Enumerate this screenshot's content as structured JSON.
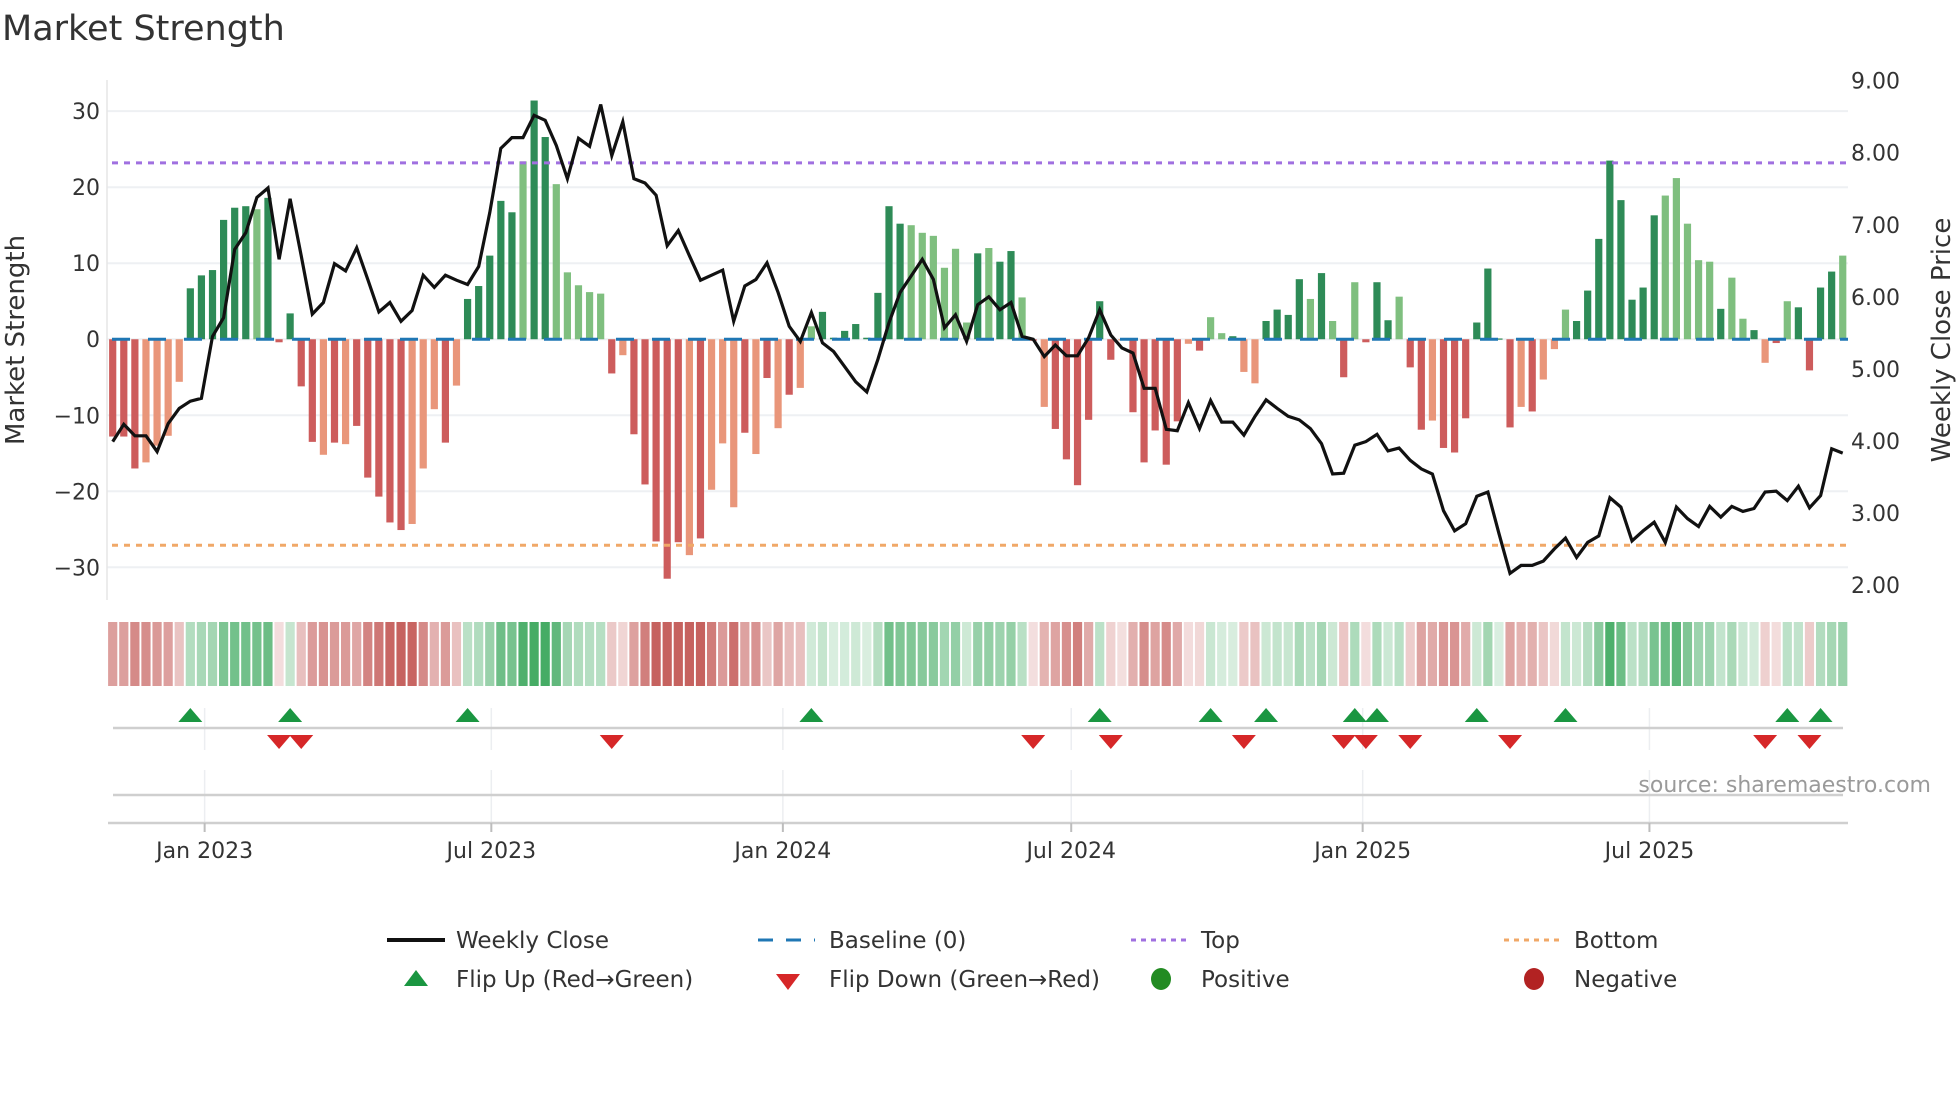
{
  "title": "Market Strength",
  "source": "source: sharemaestro.com",
  "chart_data": {
    "type": "bar+line",
    "title": "Market Strength",
    "ylabel": "Market Strength",
    "y2label": "Weekly Close Price",
    "ylim": [
      -34.3,
      34.1
    ],
    "y2lim": [
      1.79,
      9.01
    ],
    "yticks": [
      {
        "value": 30,
        "label": "30"
      },
      {
        "value": 20,
        "label": "20"
      },
      {
        "value": 10,
        "label": "10"
      },
      {
        "value": 0,
        "label": "0"
      },
      {
        "value": -10,
        "label": "−10"
      },
      {
        "value": -20,
        "label": "−20"
      },
      {
        "value": -30,
        "label": "−30"
      }
    ],
    "y2ticks": [
      {
        "value": 9,
        "label": "9.00"
      },
      {
        "value": 8,
        "label": "8.00"
      },
      {
        "value": 7,
        "label": "7.00"
      },
      {
        "value": 6,
        "label": "6.00"
      },
      {
        "value": 5,
        "label": "5.00"
      },
      {
        "value": 4,
        "label": "4.00"
      },
      {
        "value": 3,
        "label": "3.00"
      },
      {
        "value": 2,
        "label": "2.00"
      }
    ],
    "xticks": [
      {
        "label": "Jan 2023",
        "week": 9.29
      },
      {
        "label": "Jul 2023",
        "week": 35.14
      },
      {
        "label": "Jan 2024",
        "week": 61.43
      },
      {
        "label": "Jul 2024",
        "week": 87.43
      },
      {
        "label": "Jan 2025",
        "week": 113.71
      },
      {
        "label": "Jul 2025",
        "week": 139.57
      }
    ],
    "start_date": "2022-11-04",
    "frequency": "weekly",
    "baseline": 0,
    "top_level": 23.2,
    "bottom_level": -27.1,
    "strength": [
      -12.8,
      -12.8,
      -17,
      -16.2,
      -14,
      -12.7,
      -5.6,
      6.7,
      8.4,
      9.1,
      15.7,
      17.3,
      17.5,
      17.1,
      18.6,
      -0.4,
      3.4,
      -6.2,
      -13.5,
      -15.2,
      -13.6,
      -13.8,
      -11.4,
      -18.2,
      -20.7,
      -24.1,
      -25.1,
      -24.3,
      -17,
      -9.2,
      -13.6,
      -6.1,
      5.3,
      7,
      11,
      18.2,
      16.7,
      23.4,
      31.4,
      26.6,
      20.4,
      8.8,
      7.1,
      6.2,
      6,
      -4.5,
      -2.1,
      -12.5,
      -19.1,
      -26.6,
      -31.5,
      -26.7,
      -28.4,
      -26.2,
      -19.8,
      -13.7,
      -22.1,
      -12.3,
      -15.1,
      -5.1,
      -11.7,
      -7.3,
      -6.4,
      1.7,
      3.6,
      0.2,
      1.1,
      2,
      0.2,
      6.1,
      17.5,
      15.2,
      15,
      14,
      13.6,
      9.4,
      11.9,
      2.2,
      11.3,
      12,
      10.2,
      11.6,
      5.5,
      -0.2,
      -8.9,
      -11.8,
      -15.8,
      -19.2,
      -10.6,
      5,
      -2.7,
      -0.1,
      -9.6,
      -16.2,
      -12,
      -16.5,
      -10.8,
      -0.6,
      -1.5,
      2.9,
      0.8,
      0.4,
      -4.3,
      -5.8,
      2.4,
      3.9,
      3.2,
      7.9,
      5.3,
      8.7,
      2.4,
      -5,
      7.5,
      -0.4,
      7.5,
      2.5,
      5.6,
      -3.7,
      -11.9,
      -10.7,
      -14.3,
      -14.9,
      -10.4,
      2.2,
      9.3,
      0.1,
      -11.6,
      -8.9,
      -9.5,
      -5.3,
      -1.3,
      3.9,
      2.4,
      6.4,
      13.2,
      23.5,
      18.3,
      5.2,
      6.8,
      16.3,
      18.9,
      21.2,
      15.2,
      10.4,
      10.2,
      4,
      8.1,
      2.7,
      1.2,
      -3.1,
      -0.5,
      5,
      4.2,
      -4.1,
      6.8,
      8.9,
      11
    ],
    "strength_shade": "dddllllddddddldddddldldddddllldldddddlddllllldldddddldllldldldllddddddddlllllldlddldlddddddldddddldlldllddddldldldddlddldddddddldlllddddddddllllldlldldldddd",
    "close": [
      3.99,
      4.23,
      4.07,
      4.07,
      3.85,
      4.24,
      4.45,
      4.55,
      4.59,
      5.45,
      5.71,
      6.66,
      6.89,
      7.38,
      7.51,
      6.52,
      7.36,
      6.57,
      5.76,
      5.92,
      6.46,
      6.36,
      6.68,
      6.24,
      5.79,
      5.92,
      5.66,
      5.81,
      6.3,
      6.13,
      6.3,
      6.23,
      6.17,
      6.42,
      7.17,
      8.06,
      8.21,
      8.21,
      8.52,
      8.45,
      8.1,
      7.64,
      8.2,
      8.09,
      8.67,
      7.96,
      8.43,
      7.64,
      7.58,
      7.41,
      6.71,
      6.92,
      6.57,
      6.23,
      6.3,
      6.37,
      5.66,
      6.15,
      6.24,
      6.47,
      6.06,
      5.59,
      5.38,
      5.78,
      5.36,
      5.24,
      5.03,
      4.82,
      4.68,
      5.13,
      5.64,
      6.06,
      6.29,
      6.52,
      6.24,
      5.57,
      5.75,
      5.38,
      5.89,
      6.0,
      5.82,
      5.92,
      5.45,
      5.41,
      5.17,
      5.33,
      5.18,
      5.18,
      5.43,
      5.82,
      5.47,
      5.29,
      5.22,
      4.73,
      4.73,
      4.16,
      4.14,
      4.53,
      4.17,
      4.56,
      4.26,
      4.26,
      4.08,
      4.34,
      4.57,
      4.45,
      4.34,
      4.29,
      4.17,
      3.96,
      3.54,
      3.55,
      3.94,
      3.99,
      4.09,
      3.86,
      3.9,
      3.73,
      3.61,
      3.54,
      3.03,
      2.75,
      2.85,
      3.23,
      3.29,
      2.71,
      2.16,
      2.27,
      2.27,
      2.33,
      2.5,
      2.65,
      2.38,
      2.59,
      2.68,
      3.21,
      3.08,
      2.61,
      2.75,
      2.87,
      2.59,
      3.08,
      2.92,
      2.81,
      3.09,
      2.94,
      3.09,
      3.02,
      3.06,
      3.29,
      3.3,
      3.17,
      3.37,
      3.07,
      3.24,
      3.89,
      3.83
    ],
    "flip_up_weeks": [
      8,
      17,
      33,
      64,
      90,
      100,
      105,
      113,
      115,
      124,
      132,
      152,
      155
    ],
    "flip_down_weeks": [
      16,
      18,
      46,
      84,
      91,
      103,
      112,
      114,
      118,
      127,
      150,
      154
    ],
    "colors": {
      "positive_strong": "#2e8b57",
      "positive_weak": "#7fbf7f",
      "negative_strong": "#cd5c5c",
      "negative_weak": "#e9967a",
      "close": "#111111",
      "baseline": "#1f77b4",
      "top": "#a070e0",
      "bottom": "#f0a868",
      "flip_up": "#1a9641",
      "flip_down": "#d62728",
      "heat_positive": "#31a354",
      "heat_negative": "#c0504d",
      "legend_positive": "#228b22",
      "legend_negative": "#b22222"
    },
    "legend": {
      "weekly_close": "Weekly Close",
      "baseline": "Baseline (0)",
      "top": "Top",
      "bottom": "Bottom",
      "flip_up": "Flip Up (Red→Green)",
      "flip_down": "Flip Down (Green→Red)",
      "positive": "Positive",
      "negative": "Negative"
    },
    "legend_position": "bottom"
  }
}
